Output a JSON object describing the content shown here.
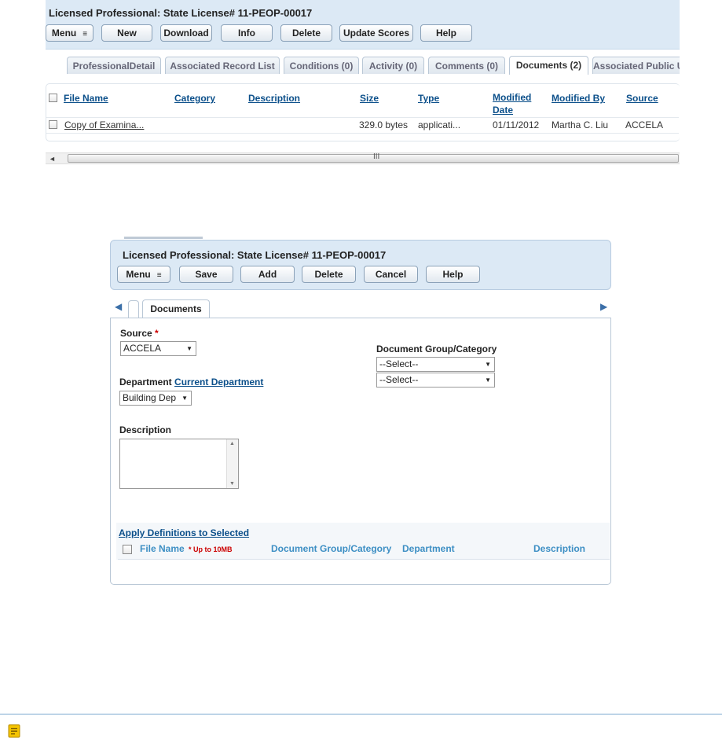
{
  "screen1": {
    "title": "Licensed Professional: State License# 11-PEOP-00017",
    "buttons": {
      "menu": "Menu",
      "new": "New",
      "download": "Download",
      "info": "Info",
      "delete": "Delete",
      "update_scores": "Update Scores",
      "help": "Help"
    },
    "menu_glyph": "≡",
    "tabs": [
      "ProfessionalDetail",
      "Associated Record List",
      "Conditions (0)",
      "Activity (0)",
      "Comments (0)",
      "Documents (2)",
      "Associated Public U"
    ],
    "columns": {
      "file_name": "File Name",
      "category": "Category",
      "description": "Description",
      "size": "Size",
      "type": "Type",
      "modified_date": "Modified Date",
      "modified_by": "Modified By",
      "source": "Source"
    },
    "row": {
      "file_name": "Copy of Examina...",
      "category": "",
      "description": "",
      "size": "329.0 bytes",
      "type": "applicati...",
      "modified_date": "01/11/2012",
      "modified_by": "Martha C. Liu",
      "source": "ACCELA"
    },
    "scroll_left": "◄",
    "scroll_grip": "III"
  },
  "screen2": {
    "title": "Licensed Professional: State License# 11-PEOP-00017",
    "buttons": {
      "menu": "Menu",
      "save": "Save",
      "add": "Add",
      "delete": "Delete",
      "cancel": "Cancel",
      "help": "Help"
    },
    "menu_glyph": "≡",
    "tab_prev": "◀",
    "tab_next": "▶",
    "tab": "Documents",
    "source": {
      "label": "Source",
      "required": "*",
      "value": "ACCELA"
    },
    "department": {
      "label": "Department",
      "link": "Current Department",
      "value": "Building Dep"
    },
    "description_label": "Description",
    "group": {
      "label": "Document Group/Category",
      "select1": "--Select--",
      "select2": "--Select--"
    },
    "apply_link": "Apply Definitions to Selected",
    "file_table": {
      "file_name": "File Name",
      "limit": "* Up to 10MB",
      "group": "Document Group/Category",
      "department": "Department",
      "description": "Description"
    },
    "caret": "▼",
    "scroll_up": "▲",
    "scroll_down": "▼"
  },
  "colors": {
    "header_bg": "#dce9f5",
    "link": "#0b4f8a",
    "column_header": "#3d8fc4",
    "required": "#cc0000",
    "note_icon": "#f5c400"
  }
}
